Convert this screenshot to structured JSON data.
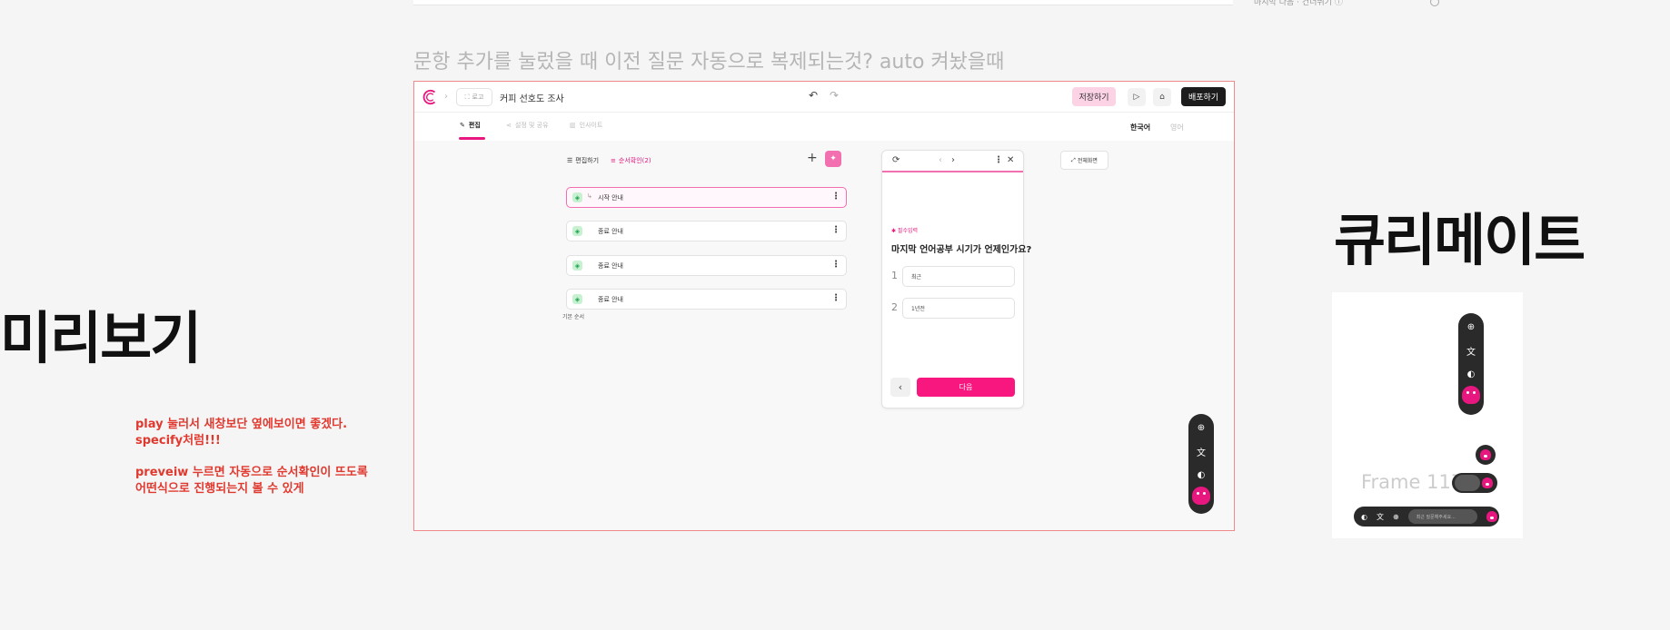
{
  "top": {
    "right_text": "마지막 다음 · 건너뛰기 ⓘ"
  },
  "heading": "문항 추가를 눌렀을 때 이전 질문 자동으로 복제되는것? auto 켜놨을때",
  "left_big": "미리보기",
  "right_big": "큐리메이트",
  "notes": {
    "line1": "play 눌러서 새창보단 옆에보이면 좋겠다.",
    "line2": "specify처럼!!!",
    "line3": "preveiw 누르면 자동으로 순서확인이 뜨도록",
    "line4": "어떤식으로 진행되는지 볼 수 있게"
  },
  "appbar": {
    "chip_label": "로고",
    "survey_title": "커피 선호도 조사",
    "undo": "↶",
    "redo": "↷",
    "save": "저장하기",
    "play": "▷",
    "tag": "⌂",
    "publish": "배포하기"
  },
  "tabs": {
    "edit": "편집",
    "share": "설정 및 공유",
    "insight": "인사이트"
  },
  "languages": {
    "korean": "한국어",
    "english": "영어"
  },
  "editor": {
    "edit_label": "편집하기",
    "order_label": "순서확인(2)",
    "rows": [
      {
        "label": "시작 안내"
      },
      {
        "label": "종료 안내"
      },
      {
        "label": "종료 안내"
      },
      {
        "label": "종료 안내"
      }
    ],
    "base_order": "기본 순서"
  },
  "preview": {
    "required": "✱ 필수입력",
    "question": "마지막 언어공부 시기가 언제인가요?",
    "options": [
      {
        "num": "1",
        "text": "최근"
      },
      {
        "num": "2",
        "text": "1년전"
      }
    ],
    "next": "다음"
  },
  "fullscreen": "전체화면",
  "right_frame": {
    "label": "Frame 117",
    "input_placeholder": "최근 질문해주세요..."
  },
  "colors": {
    "accent": "#e8177f",
    "note_red": "#e0392f",
    "frame_border": "#f08a8a"
  }
}
